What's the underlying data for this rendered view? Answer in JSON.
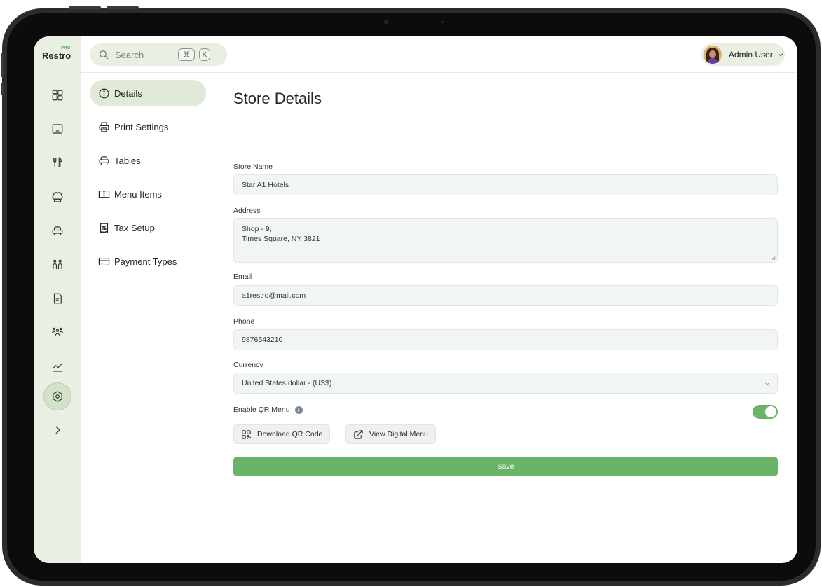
{
  "app": {
    "brand": "Restro",
    "brand_badge": "PRO"
  },
  "search": {
    "placeholder": "Search",
    "shortcut_mod": "⌘",
    "shortcut_key": "K"
  },
  "user": {
    "name": "Admin User"
  },
  "rail": {
    "icons": [
      "dashboard-icon",
      "pos-terminal-icon",
      "cutlery-icon",
      "chef-hat-icon",
      "table-icon",
      "staff-icon",
      "invoice-icon",
      "customers-icon",
      "reports-icon",
      "settings-icon",
      "expand-icon"
    ],
    "active": "settings-icon"
  },
  "subnav": {
    "items": [
      {
        "label": "Details",
        "icon": "info-icon",
        "active": true
      },
      {
        "label": "Print Settings",
        "icon": "printer-icon"
      },
      {
        "label": "Tables",
        "icon": "table-icon"
      },
      {
        "label": "Menu Items",
        "icon": "book-icon"
      },
      {
        "label": "Tax Setup",
        "icon": "receipt-percent-icon"
      },
      {
        "label": "Payment Types",
        "icon": "credit-card-icon"
      }
    ]
  },
  "form": {
    "title": "Store Details",
    "store_name": {
      "label": "Store Name",
      "value": "Star A1 Hotels"
    },
    "address": {
      "label": "Address",
      "value": "Shop - 9,\nTimes Square, NY 3821"
    },
    "email": {
      "label": "Email",
      "value": "a1restro@mail.com"
    },
    "phone": {
      "label": "Phone",
      "value": "9876543210"
    },
    "currency": {
      "label": "Currency",
      "value": "United States dollar - (US$)"
    },
    "qr_menu": {
      "label": "Enable QR Menu",
      "enabled": true
    },
    "download_qr_label": "Download QR Code",
    "view_menu_label": "View Digital Menu",
    "save_label": "Save"
  },
  "colors": {
    "accent": "#6ab46a",
    "sidebar_bg": "#e9efe3",
    "active_nav": "#e1ead9",
    "field_bg": "#f1f6f3"
  }
}
